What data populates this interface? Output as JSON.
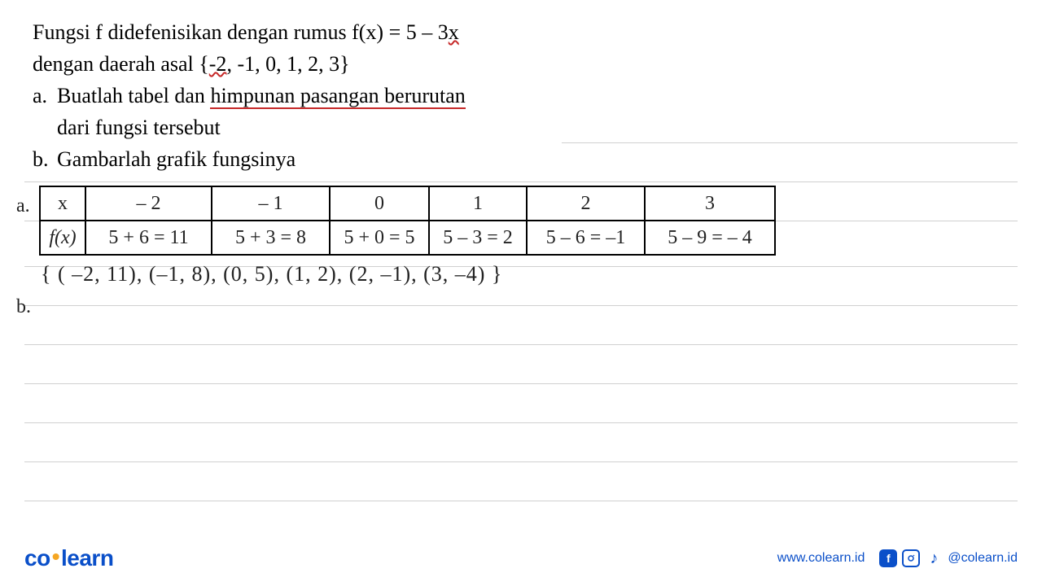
{
  "problem": {
    "line1_a": "Fungsi f didefenisikan dengan rumus f(x) = 5 – 3",
    "line1_b": "x",
    "line2_a": "dengan daerah asal {",
    "line2_b": "-2",
    "line2_c": ", -1, 0, 1, 2, 3}",
    "item_a_marker": "a.",
    "item_a_text1": "Buatlah tabel dan ",
    "item_a_text2": "himpunan pasangan berurutan",
    "item_a_text3": "dari fungsi tersebut",
    "item_b_marker": "b.",
    "item_b_text": "Gambarlah grafik fungsinya"
  },
  "handwritten": {
    "label_a": "a.",
    "label_b": "b.",
    "table": {
      "row1": {
        "hdr": "x",
        "c1": "– 2",
        "c2": "– 1",
        "c3": "0",
        "c4": "1",
        "c5": "2",
        "c6": "3"
      },
      "row2": {
        "hdr": "f(x)",
        "c1": "5 + 6 = 11",
        "c2": "5 + 3 = 8",
        "c3": "5 + 0 = 5",
        "c4": "5 – 3 = 2",
        "c5": "5 – 6 = –1",
        "c6": "5 – 9 = – 4"
      }
    },
    "set": "{ ( –2, 11), (–1, 8), (0, 5), (1, 2), (2, –1), (3, –4) }"
  },
  "footer": {
    "logo_a": "co",
    "logo_b": "learn",
    "url": "www.colearn.id",
    "handle": "@colearn.id"
  },
  "chart_data": {
    "type": "table",
    "title": "Tabel fungsi f(x) = 5 - 3x",
    "columns": [
      "x",
      "f(x)"
    ],
    "rows": [
      [
        -2,
        11
      ],
      [
        -1,
        8
      ],
      [
        0,
        5
      ],
      [
        1,
        2
      ],
      [
        2,
        -1
      ],
      [
        3,
        -4
      ]
    ],
    "ordered_pairs": [
      [
        -2,
        11
      ],
      [
        -1,
        8
      ],
      [
        0,
        5
      ],
      [
        1,
        2
      ],
      [
        2,
        -1
      ],
      [
        3,
        -4
      ]
    ]
  }
}
